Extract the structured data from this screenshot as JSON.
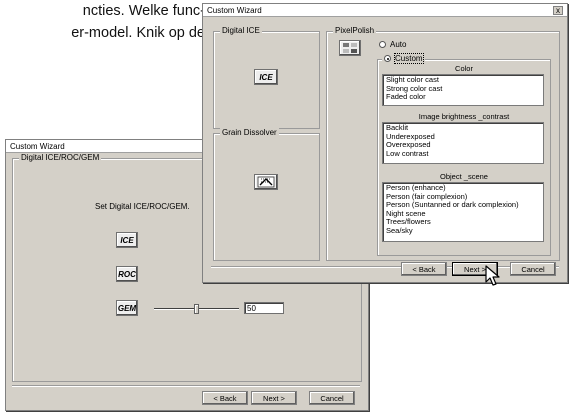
{
  "document": {
    "line1": "ncties. Welke func-",
    "line2": "er-model. Knik op de"
  },
  "back_window": {
    "title": "Custom Wizard",
    "group_label": "Digital ICE/ROC/GEM",
    "heading": "Set Digital ICE/ROC/GEM.",
    "ice_label": "ICE",
    "roc_label": "ROC",
    "gem_label": "GEM",
    "gem_value": "50",
    "gem_level": 0.5,
    "buttons": {
      "back": "< Back",
      "next": "Next >",
      "cancel": "Cancel"
    }
  },
  "front_window": {
    "title": "Custom Wizard",
    "close": "x",
    "digital_ice": {
      "label": "Digital ICE",
      "icon_label": "ICE"
    },
    "grain_dissolver": {
      "label": "Grain Dissolver"
    },
    "pixelpolish": {
      "label": "PixelPolish",
      "auto_label": "Auto",
      "custom_label": "Custom",
      "selected": "Custom",
      "custom_group_label": "Custom",
      "color_label": "Color",
      "color_items": [
        "Slight color cast",
        "Strong color cast",
        "Faded color"
      ],
      "brightness_label": "Image brightness _contrast",
      "brightness_items": [
        "Backlit",
        "Underexposed",
        "Overexposed",
        "Low contrast"
      ],
      "scene_label": "Object _scene",
      "scene_items": [
        "Person (enhance)",
        "Person (fair complexion)",
        "Person (Suntanned or dark complexion)",
        "Night scene",
        "Trees/flowers",
        "Sea/sky"
      ]
    },
    "buttons": {
      "back": "< Back",
      "next": "Next >",
      "cancel": "Cancel"
    }
  }
}
